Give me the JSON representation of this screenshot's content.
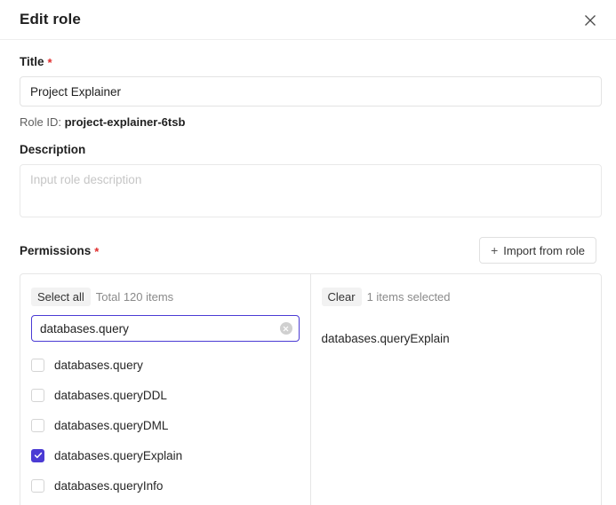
{
  "header": {
    "title": "Edit role",
    "close_icon": "close-icon"
  },
  "form": {
    "title_label": "Title",
    "title_required": "*",
    "title_value": "Project Explainer",
    "title_placeholder": "",
    "role_id_prefix": "Role ID:",
    "role_id_value": "project-explainer-6tsb",
    "description_label": "Description",
    "description_value": "",
    "description_placeholder": "Input role description"
  },
  "permissions": {
    "label": "Permissions",
    "required": "*",
    "import_button": "Import from role",
    "import_icon": "plus-icon",
    "left_panel": {
      "select_all_label": "Select all",
      "total_text": "Total 120 items",
      "search_value": "databases.query",
      "search_placeholder": "",
      "clear_search_icon": "clear-circle-icon",
      "options": [
        {
          "label": "databases.query",
          "checked": false
        },
        {
          "label": "databases.queryDDL",
          "checked": false
        },
        {
          "label": "databases.queryDML",
          "checked": false
        },
        {
          "label": "databases.queryExplain",
          "checked": true
        },
        {
          "label": "databases.queryInfo",
          "checked": false
        }
      ]
    },
    "right_panel": {
      "clear_label": "Clear",
      "selected_text": "1 items selected",
      "items": [
        {
          "label": "databases.queryExplain"
        }
      ]
    }
  },
  "colors": {
    "accent": "#4b3bd4",
    "required": "#e02b2b",
    "border": "#e6e6e6",
    "muted_text": "#8a8a8a"
  }
}
